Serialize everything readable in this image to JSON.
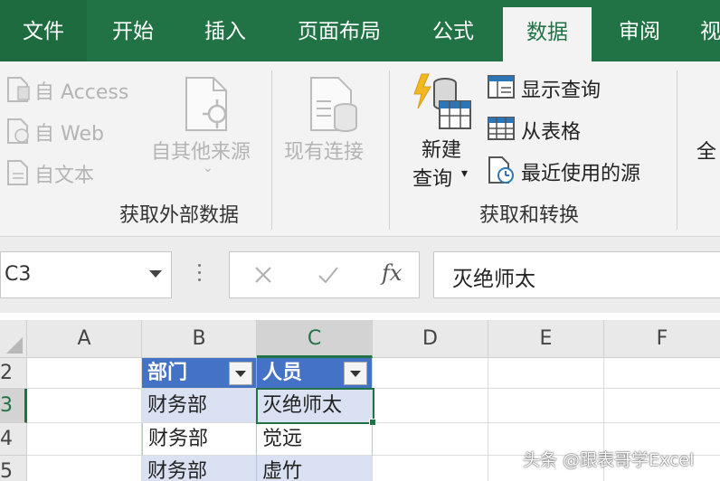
{
  "tabs": {
    "file": "文件",
    "home": "开始",
    "insert": "插入",
    "layout": "页面布局",
    "formulas": "公式",
    "data": "数据",
    "review": "审阅",
    "view": "视"
  },
  "ribbon": {
    "from_access": "自 Access",
    "from_web": "自 Web",
    "from_text": "自文本",
    "from_other": "自其他来源",
    "existing_connections": "现有连接",
    "group_external": "获取外部数据",
    "new_query_line1": "新建",
    "new_query_line2": "查询",
    "show_queries": "显示查询",
    "from_table": "从表格",
    "recent_sources": "最近使用的源",
    "group_transform": "获取和转换",
    "refresh_all_partial": "全"
  },
  "formula_bar": {
    "name_box": "C3",
    "fx": "fx",
    "value": "灭绝师太"
  },
  "grid": {
    "columns": [
      "A",
      "B",
      "C",
      "D",
      "E",
      "F"
    ],
    "rows": [
      "2",
      "3",
      "4",
      "5"
    ],
    "header": {
      "dept": "部门",
      "person": "人员"
    },
    "data": [
      {
        "dept": "财务部",
        "person": "灭绝师太"
      },
      {
        "dept": "财务部",
        "person": "觉远"
      },
      {
        "dept": "财务部",
        "person": "虚竹"
      }
    ]
  },
  "watermark": "头条 @跟表哥学Excel",
  "colors": {
    "excel_green": "#217346",
    "table_header": "#4472c4",
    "table_band": "#d9e1f2"
  }
}
